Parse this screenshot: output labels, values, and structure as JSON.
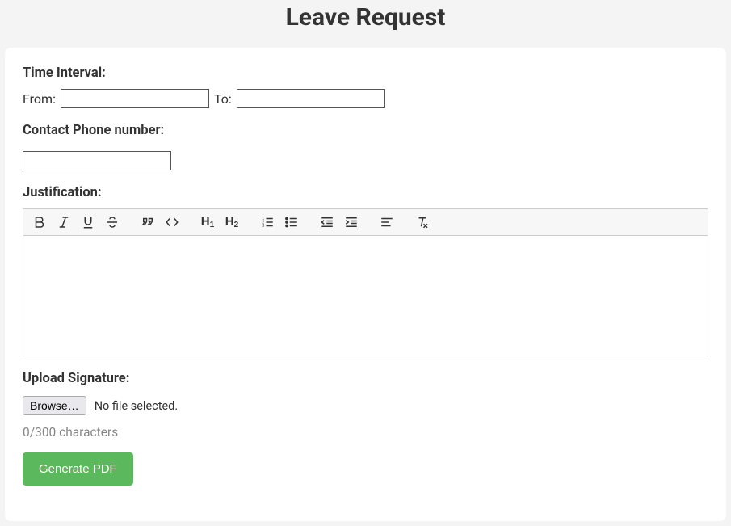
{
  "title": "Leave Request",
  "form": {
    "timeIntervalLabel": "Time Interval:",
    "fromLabel": "From:",
    "toLabel": "To:",
    "fromValue": "",
    "toValue": "",
    "phoneLabel": "Contact Phone number:",
    "phoneValue": "",
    "justificationLabel": "Justification:",
    "uploadLabel": "Upload Signature:",
    "browseLabel": "Browse…",
    "fileSelectedText": "No file selected.",
    "charCounter": "0/300 characters",
    "generateLabel": "Generate PDF"
  }
}
